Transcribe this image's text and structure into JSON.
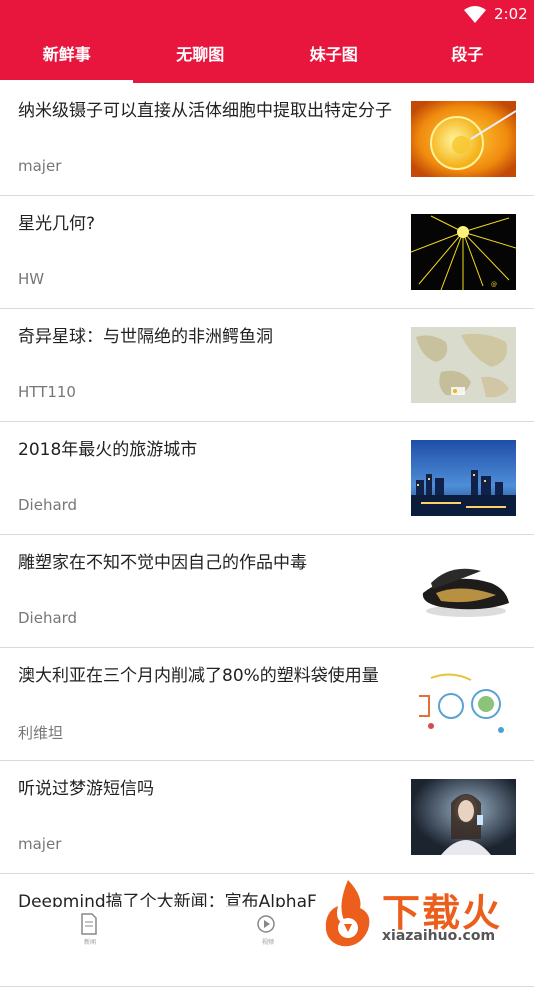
{
  "status": {
    "time": "2:02"
  },
  "tabs": [
    {
      "label": "新鲜事",
      "active": true
    },
    {
      "label": "无聊图",
      "active": false
    },
    {
      "label": "妹子图",
      "active": false
    },
    {
      "label": "段子",
      "active": false
    }
  ],
  "items": [
    {
      "title": "纳米级镊子可以直接从活体细胞中提取出特定分子",
      "author": "majer",
      "thumb": "cell-image"
    },
    {
      "title": "星光几何?",
      "author": "HW",
      "thumb": "starlight-image"
    },
    {
      "title": "奇异星球：与世隔绝的非洲鳄鱼洞",
      "author": "HTT110",
      "thumb": "map-image"
    },
    {
      "title": "2018年最火的旅游城市",
      "author": "Diehard",
      "thumb": "city-image"
    },
    {
      "title": "雕塑家在不知不觉中因自己的作品中毒",
      "author": "Diehard",
      "thumb": "mussel-image"
    },
    {
      "title": "澳大利亚在三个月内削减了80%的塑料袋使用量",
      "author": "利维坦",
      "thumb": "doodle-image"
    },
    {
      "title": "听说过梦游短信吗",
      "author": "majer",
      "thumb": "phone-girl-image"
    },
    {
      "title": "Deepmind搞了个大新闻：宣布AlphaF",
      "author": "",
      "thumb": ""
    }
  ],
  "bottom": {
    "left_label": "新闻",
    "right_label": "视频"
  },
  "watermark": {
    "brand": "下载火",
    "url": "xiazaihuo.com"
  },
  "colors": {
    "accent": "#e8163d",
    "watermark": "#ec5e1c"
  }
}
